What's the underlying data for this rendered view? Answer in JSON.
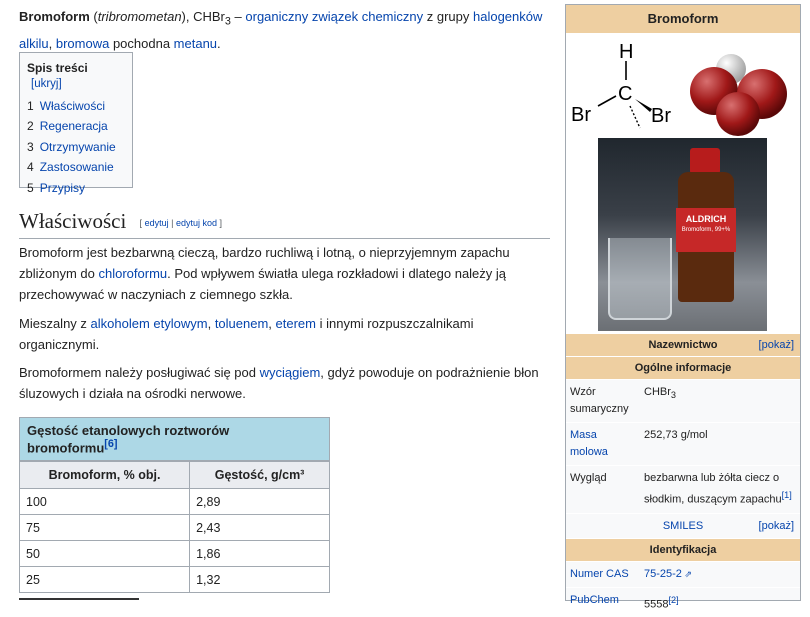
{
  "lead": {
    "title_bold": "Bromoform",
    "alt_name": "tribromometan",
    "formula": "CHBr",
    "formula_sub": "3",
    "dash": " – ",
    "link1": "organiczny związek chemiczny",
    "text1": " z grupy ",
    "link2": "halogenków alkilu",
    "text2": ", ",
    "link3": "bromowa",
    "text3": " pochodna ",
    "link4": "metanu",
    "text4": "."
  },
  "toc": {
    "title": "Spis treści",
    "toggle": "[ukryj]",
    "items": [
      {
        "num": "1",
        "label": "Właściwości"
      },
      {
        "num": "2",
        "label": "Regeneracja"
      },
      {
        "num": "3",
        "label": "Otrzymywanie"
      },
      {
        "num": "4",
        "label": "Zastosowanie"
      },
      {
        "num": "5",
        "label": "Przypisy"
      }
    ]
  },
  "section": {
    "heading": "Właściwości",
    "edit": "edytuj",
    "sep": " | ",
    "edit_code": "edytuj kod",
    "open": "[ ",
    "close": " ]"
  },
  "p1": {
    "t1": "Bromoform jest bezbarwną cieczą, bardzo ruchliwą i lotną, o nieprzyjemnym zapachu zbliżonym do ",
    "link": "chloroformu",
    "t2": ". Pod wpływem światła ulega rozkładowi i dlatego należy ją przechowywać w naczyniach z ciemnego szkła."
  },
  "p2": {
    "t1": "Mieszalny z ",
    "l1": "alkoholem etylowym",
    "s1": ", ",
    "l2": "toluenem",
    "s2": ", ",
    "l3": "eterem",
    "t2": " i innymi rozpuszczalnikami organicznymi."
  },
  "p3": {
    "t1": "Bromoformem należy posługiwać się pod ",
    "link": "wyciągiem",
    "t2": ", gdyż powoduje on podrażnienie błon śluzowych i działa na ośrodki nerwowe."
  },
  "density_table": {
    "caption": "Gęstość etanolowych roztworów bromoformu",
    "caption_ref": "[6]",
    "headers": [
      "Bromoform, % obj.",
      "Gęstość, g/cm³"
    ],
    "rows": [
      [
        "100",
        "2,89"
      ],
      [
        "75",
        "2,43"
      ],
      [
        "50",
        "1,86"
      ],
      [
        "25",
        "1,32"
      ]
    ]
  },
  "infobox": {
    "title": "Bromoform",
    "struct": {
      "h": "H",
      "c": "C",
      "br1": "Br",
      "br2": "Br",
      "br3": "Br"
    },
    "bottle_label": "ALDRICH",
    "bottle_sub": "Bromoform, 99+%",
    "nazewnictwo": "Nazewnictwo",
    "pokaz": "[pokaż]",
    "ogolne": "Ogólne informacje",
    "rows": {
      "wzor_label": "Wzór sumaryczny",
      "wzor_value": "CHBr",
      "wzor_sub": "3",
      "masa_label": "Masa molowa",
      "masa_value": "252,73 g/mol",
      "wyglad_label": "Wygląd",
      "wyglad_value": "bezbarwna lub żółta ciecz o słodkim, duszącym zapachu",
      "wyglad_ref": "[1]"
    },
    "smiles": "SMILES",
    "identyfikacja": "Identyfikacja",
    "cas_label": "Numer CAS",
    "cas_value": "75-25-2",
    "pubchem_label": "PubChem",
    "pubchem_value": "5558",
    "pubchem_ref": "[2]"
  },
  "colors": {
    "link": "#0645ad",
    "infobox_header": "#eecfa1",
    "table_caption": "#add8e6"
  }
}
